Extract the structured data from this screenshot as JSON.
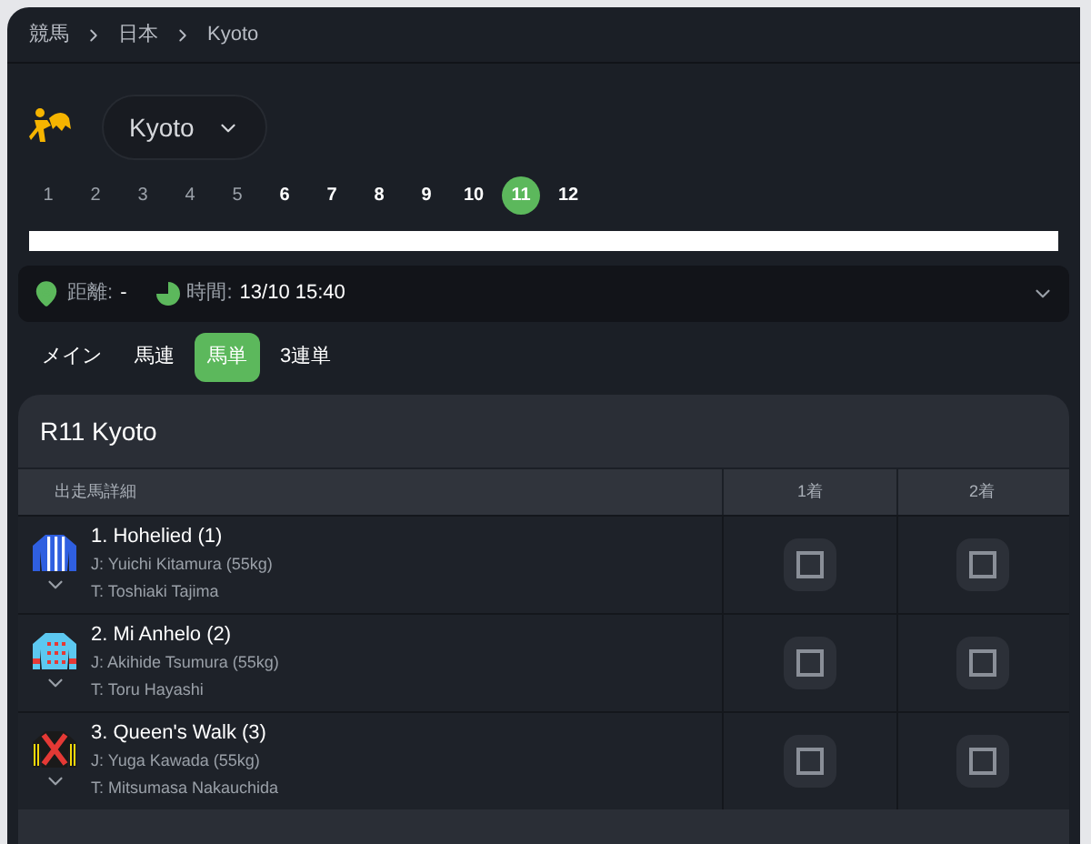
{
  "breadcrumb": [
    "競馬",
    "日本",
    "Kyoto"
  ],
  "venue": {
    "value": "Kyoto"
  },
  "races": [
    {
      "label": "1",
      "disabled": true,
      "selected": false
    },
    {
      "label": "2",
      "disabled": true,
      "selected": false
    },
    {
      "label": "3",
      "disabled": true,
      "selected": false
    },
    {
      "label": "4",
      "disabled": true,
      "selected": false
    },
    {
      "label": "5",
      "disabled": true,
      "selected": false
    },
    {
      "label": "6",
      "disabled": false,
      "selected": false
    },
    {
      "label": "7",
      "disabled": false,
      "selected": false
    },
    {
      "label": "8",
      "disabled": false,
      "selected": false
    },
    {
      "label": "9",
      "disabled": false,
      "selected": false
    },
    {
      "label": "10",
      "disabled": false,
      "selected": false
    },
    {
      "label": "11",
      "disabled": false,
      "selected": true
    },
    {
      "label": "12",
      "disabled": false,
      "selected": false
    }
  ],
  "info": {
    "distance_label": "距離:",
    "distance_value": "-",
    "time_label": "時間:",
    "time_value": "13/10 15:40"
  },
  "bet_tabs": [
    {
      "label": "メイン",
      "selected": false
    },
    {
      "label": "馬連",
      "selected": false
    },
    {
      "label": "馬単",
      "selected": true
    },
    {
      "label": "3連単",
      "selected": false
    }
  ],
  "race": {
    "title": "R11 Kyoto",
    "columns": [
      "出走馬詳細",
      "1着",
      "2着"
    ],
    "runners": [
      {
        "name": "1. Hohelied (1)",
        "jockey": "J: Yuichi Kitamura (55kg)",
        "trainer": "T: Toshiaki Tajima",
        "kind": "stripes",
        "first": false,
        "second": false
      },
      {
        "name": "2. Mi Anhelo (2)",
        "jockey": "J: Akihide Tsumura (55kg)",
        "trainer": "T: Toru Hayashi",
        "kind": "dots",
        "first": false,
        "second": false
      },
      {
        "name": "3. Queen's Walk (3)",
        "jockey": "J: Yuga Kawada (55kg)",
        "trainer": "T: Mitsumasa Nakauchida",
        "kind": "cross",
        "first": false,
        "second": false
      }
    ]
  }
}
